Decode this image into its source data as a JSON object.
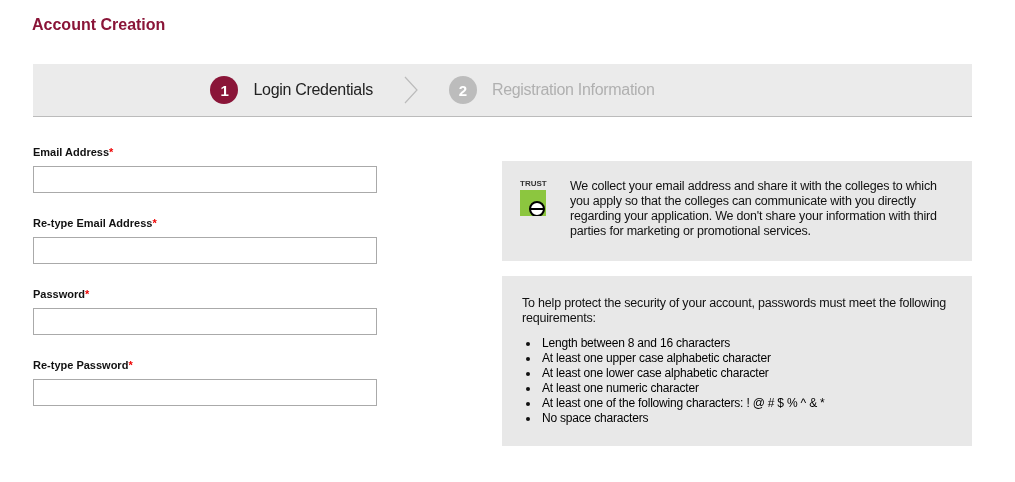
{
  "title": "Account Creation",
  "steps": [
    {
      "number": "1",
      "label": "Login Credentials",
      "selected": true
    },
    {
      "number": "2",
      "label": "Registration Information",
      "selected": false
    }
  ],
  "fields": [
    {
      "label": "Email Address",
      "required": "*"
    },
    {
      "label": "Re-type Email Address",
      "required": "*"
    },
    {
      "label": "Password",
      "required": "*"
    },
    {
      "label": "Re-type Password",
      "required": "*"
    }
  ],
  "privacy_panel": {
    "badge": "TRUST",
    "text": "We collect your email address and share it with the colleges to which you apply so that the colleges can communicate with you directly regarding your application. We don't share your information with third parties for marketing or promotional services."
  },
  "password_panel": {
    "intro": "To help protect the security of your account, passwords must meet the following requirements:",
    "requirements": [
      "Length between 8 and 16 characters",
      "At least one upper case alphabetic character",
      "At least one lower case alphabetic character",
      "At least one numeric character",
      "At least one of the following characters: ! @ # $ % ^ & *",
      "No space characters"
    ]
  }
}
